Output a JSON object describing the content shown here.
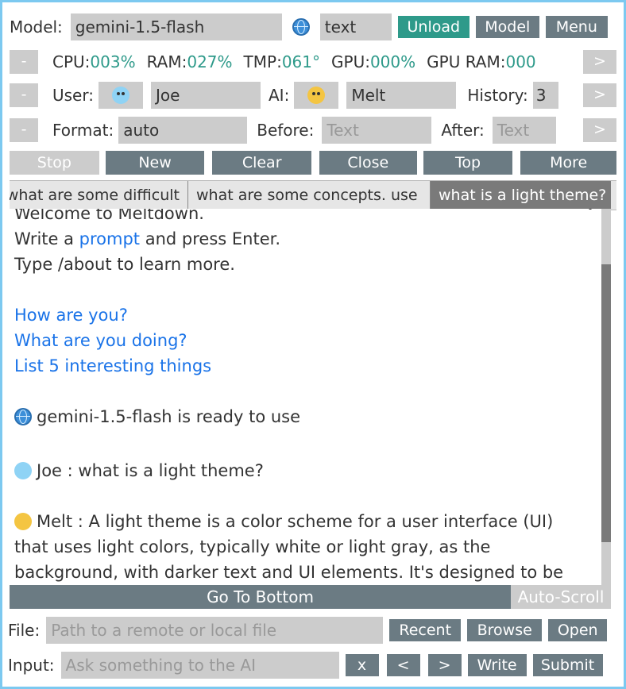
{
  "model_row": {
    "label": "Model:",
    "model_value": "gemini-1.5-flash",
    "mode_icon": "globe-icon",
    "mode_value": "text",
    "unload_label": "Unload",
    "model_button": "Model",
    "menu_button": "Menu"
  },
  "stats_row": {
    "collapse": "-",
    "cpu_label": "CPU:",
    "cpu_value": "003%",
    "ram_label": "RAM:",
    "ram_value": "027%",
    "tmp_label": "TMP:",
    "tmp_value": "061°",
    "gpu_label": "GPU:",
    "gpu_value": "000%",
    "gpuram_label": "GPU RAM:",
    "gpuram_value": "000",
    "expand": ">"
  },
  "user_row": {
    "collapse": "-",
    "user_label": "User:",
    "user_icon": "cold-face-icon",
    "user_name": "Joe",
    "ai_label": "AI:",
    "ai_icon": "melting-face-icon",
    "ai_name": "Melt",
    "history_label": "History:",
    "history_value": "3",
    "expand": ">"
  },
  "format_row": {
    "collapse": "-",
    "format_label": "Format:",
    "format_value": "auto",
    "before_label": "Before:",
    "before_placeholder": "Text",
    "after_label": "After:",
    "after_placeholder": "Text",
    "expand": ">"
  },
  "actions": {
    "stop": "Stop",
    "new": "New",
    "clear": "Clear",
    "close": "Close",
    "top": "Top",
    "more": "More"
  },
  "tabs": [
    {
      "label": "what are some difficult"
    },
    {
      "label": "what are some concepts. use"
    },
    {
      "label": "what is a light theme?"
    }
  ],
  "chat": {
    "welcome": "Welcome to Meltdown.",
    "write_pre": "Write a ",
    "write_link": "prompt",
    "write_post": " and press Enter.",
    "about": "Type /about to learn more.",
    "suggestions": [
      "How are you?",
      "What are you doing?",
      "List 5 interesting things"
    ],
    "ready": "gemini-1.5-flash is ready to use",
    "user_msg": "Joe : what is a light theme?",
    "ai_msg_1": "Melt : A light theme is a color scheme for a user interface (UI)",
    "ai_msg_2": "that uses light colors, typically white or light gray, as the",
    "ai_msg_3": "background, with darker text and UI elements.  It's designed to be"
  },
  "bottom": {
    "go_to_bottom": "Go To Bottom",
    "auto_scroll": "Auto-Scroll"
  },
  "file_row": {
    "label": "File:",
    "placeholder": "Path to a remote or local file",
    "recent": "Recent",
    "browse": "Browse",
    "open": "Open"
  },
  "input_row": {
    "label": "Input:",
    "placeholder": "Ask something to the AI",
    "clear": "x",
    "prev": "<",
    "next": ">",
    "write": "Write",
    "submit": "Submit"
  },
  "colors": {
    "accent_teal": "#2e9a8a",
    "button_gray": "#6b7b83",
    "field_gray": "#cccccc",
    "link_blue": "#1a73e8",
    "frame_border": "#7cc9f0"
  }
}
